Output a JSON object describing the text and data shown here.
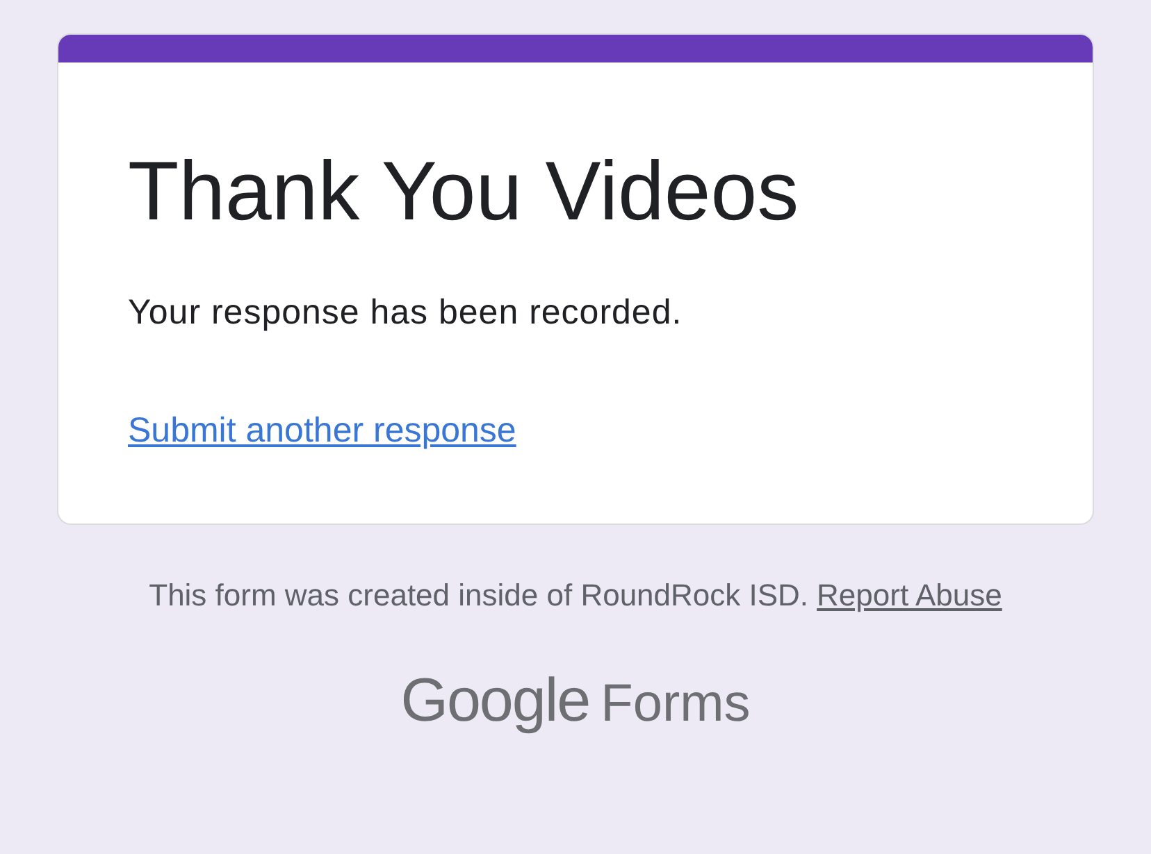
{
  "form": {
    "title": "Thank You Videos",
    "message": "Your response has been recorded.",
    "link": "Submit another response"
  },
  "footer": {
    "note": "This form was created inside of RoundRock ISD.",
    "report_link": "Report Abuse"
  },
  "logo": {
    "brand": "Google",
    "product": "Forms"
  }
}
